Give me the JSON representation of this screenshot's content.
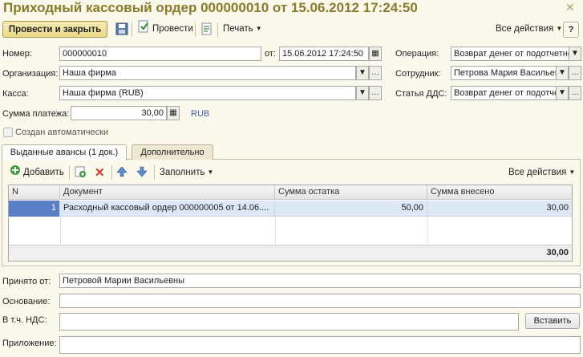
{
  "window": {
    "title": "Приходный кассовый ордер 000000010 от 15.06.2012 17:24:50"
  },
  "toolbar": {
    "post_close_label": "Провести и закрыть",
    "post_label": "Провести",
    "print_label": "Печать",
    "all_actions_label": "Все действия"
  },
  "fields": {
    "number_label": "Номер:",
    "number_value": "000000010",
    "date_label": "от:",
    "date_value": "15.06.2012 17:24:50",
    "operation_label": "Операция:",
    "operation_value": "Возврат денег от подотчетного лица",
    "org_label": "Организация:",
    "org_value": "Наша фирма",
    "employee_label": "Сотрудник:",
    "employee_value": "Петрова Мария Васильевна",
    "cash_label": "Касса:",
    "cash_value": "Наша фирма (RUB)",
    "dds_label": "Статья ДДС:",
    "dds_value": "Возврат денег от подотчетного лица",
    "amount_label": "Сумма платежа:",
    "amount_value": "30,00",
    "currency": "RUB",
    "auto_created_label": "Создан автоматически"
  },
  "tabs": [
    {
      "label": "Выданные авансы (1 док.)"
    },
    {
      "label": "Дополнительно"
    }
  ],
  "table_toolbar": {
    "add_label": "Добавить",
    "fill_label": "Заполнить",
    "all_actions_label": "Все действия"
  },
  "table": {
    "columns": [
      "N",
      "Документ",
      "Сумма остатка",
      "Сумма внесено"
    ],
    "rows": [
      {
        "n": "1",
        "document": "Расходный кассовый ордер 000000005 от 14.06....",
        "remainder": "50,00",
        "paid": "30,00"
      }
    ],
    "total_paid": "30,00"
  },
  "bottom": {
    "received_from_label": "Принято от:",
    "received_from_value": "Петровой Марии Васильевны",
    "basis_label": "Основание:",
    "basis_value": "",
    "vat_label": "В т.ч. НДС:",
    "vat_value": "",
    "insert_label": "Вставить",
    "attachment_label": "Приложение:",
    "attachment_value": ""
  }
}
